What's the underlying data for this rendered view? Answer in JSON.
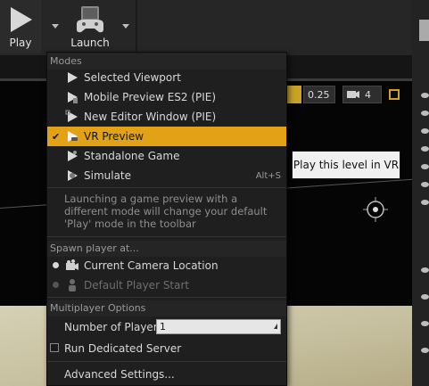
{
  "toolbar": {
    "play_label": "Play",
    "launch_label": "Launch"
  },
  "viewport": {
    "snap_value": "0.25",
    "camera_speed": "4"
  },
  "menu": {
    "modes_header": "Modes",
    "modes": [
      {
        "label": "Selected Viewport",
        "icon": "play-icon",
        "shortcut": ""
      },
      {
        "label": "Mobile Preview ES2 (PIE)",
        "icon": "mobile-preview-icon",
        "shortcut": ""
      },
      {
        "label": "New Editor Window (PIE)",
        "icon": "new-window-icon",
        "shortcut": ""
      },
      {
        "label": "VR Preview",
        "icon": "vr-headset-icon",
        "shortcut": "",
        "selected": true
      },
      {
        "label": "Standalone Game",
        "icon": "standalone-game-icon",
        "shortcut": ""
      },
      {
        "label": "Simulate",
        "icon": "simulate-icon",
        "shortcut": "Alt+S"
      }
    ],
    "description": "Launching a game preview with a different mode will change your default 'Play' mode in the toolbar",
    "spawn_header": "Spawn player at...",
    "spawn": [
      {
        "label": "Current Camera Location",
        "selected": true
      },
      {
        "label": "Default Player Start",
        "selected": false
      }
    ],
    "multiplayer_header": "Multiplayer Options",
    "num_players_label": "Number of Players",
    "num_players_value": "1",
    "dedicated_server_label": "Run Dedicated Server",
    "advanced_label": "Advanced Settings..."
  },
  "tooltip": {
    "text": "Play this level in VR"
  },
  "colors": {
    "accent": "#e2a218",
    "menu_bg": "#1f1f1f",
    "toolbar_bg": "#262626"
  }
}
